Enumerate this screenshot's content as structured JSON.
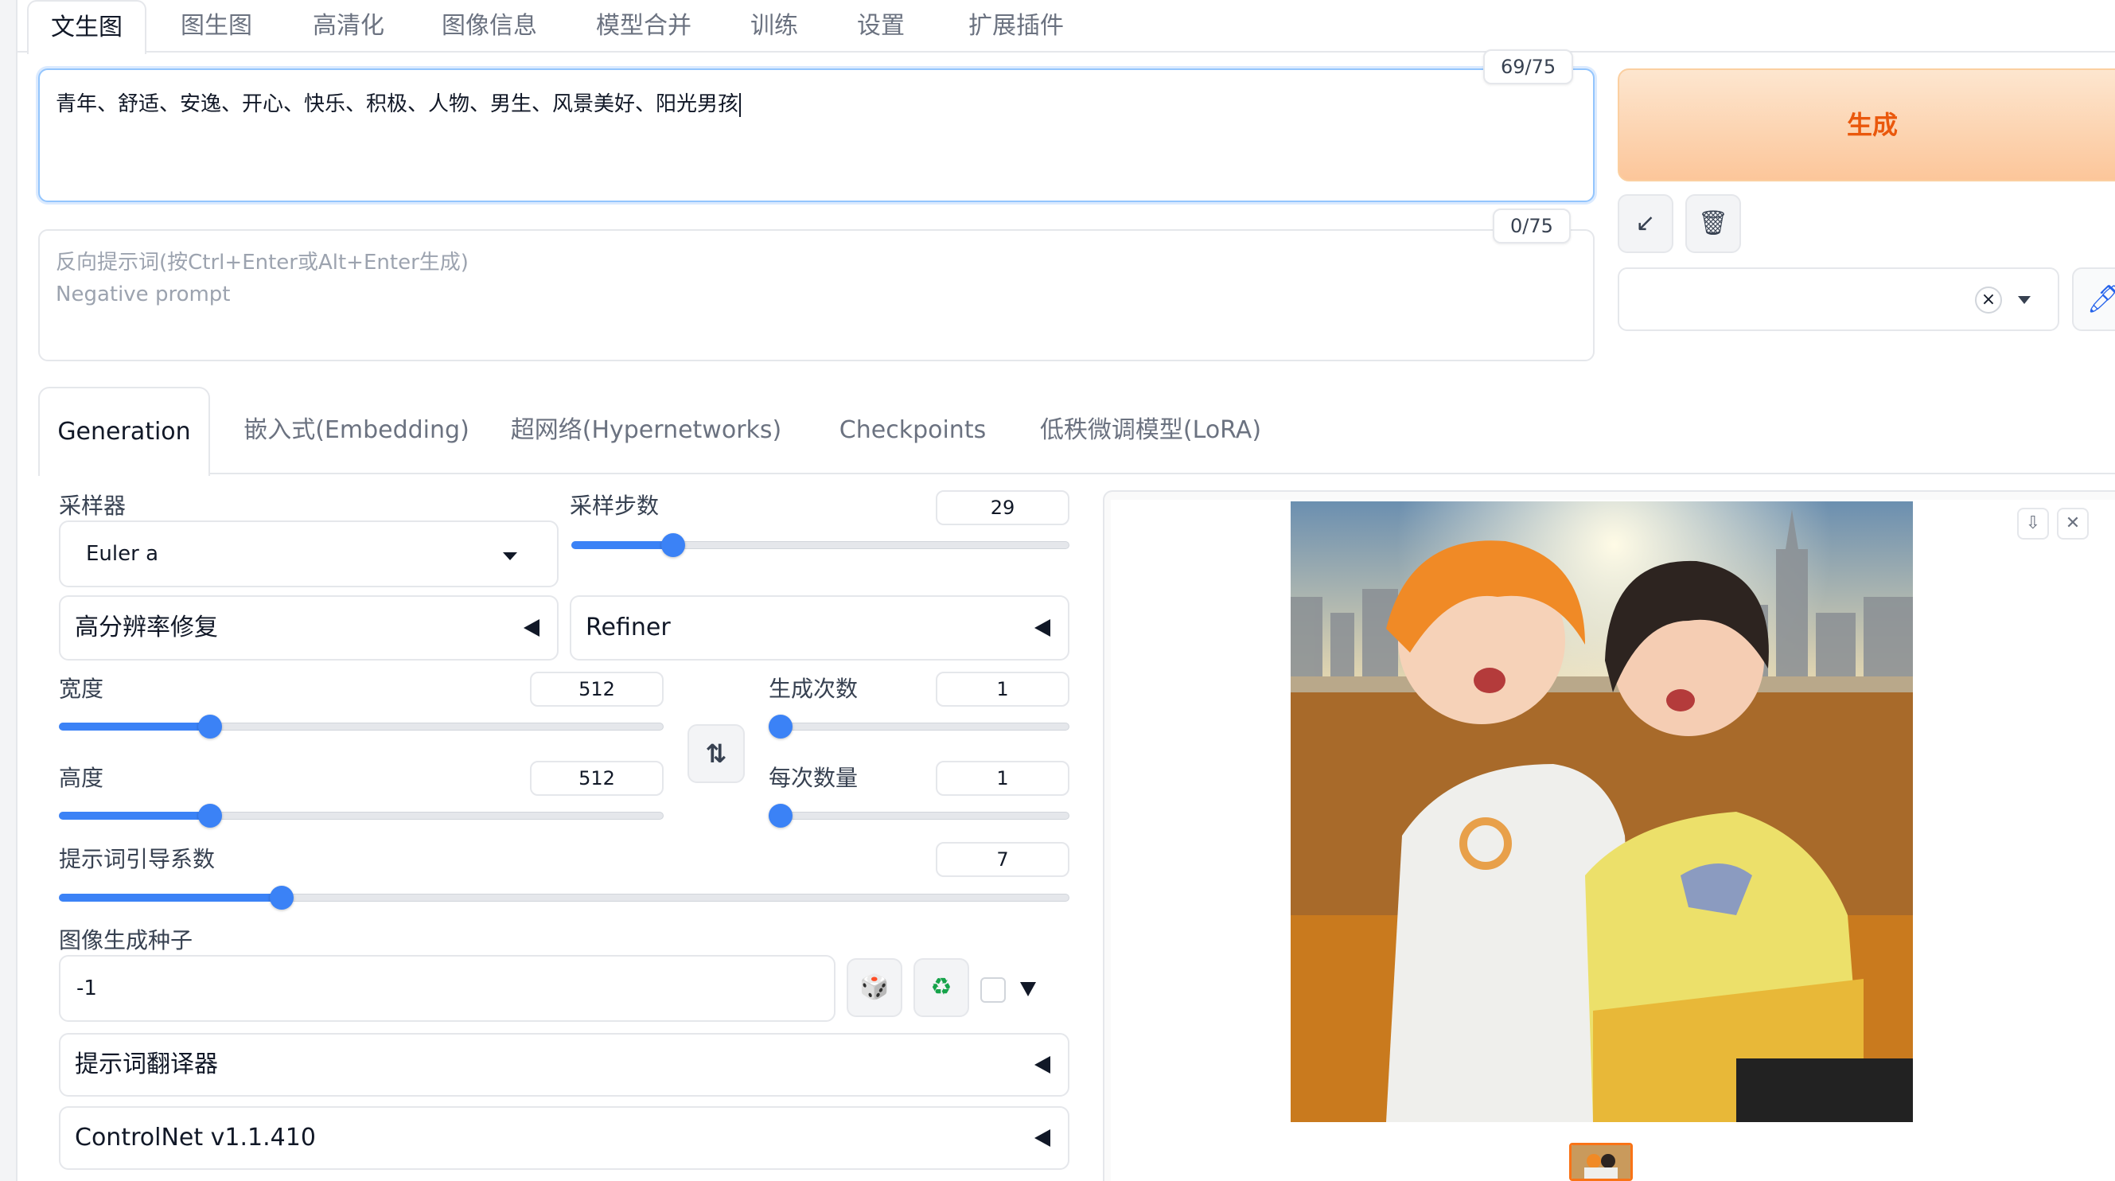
{
  "top_tabs": [
    "文生图",
    "图生图",
    "高清化",
    "图像信息",
    "模型合并",
    "训练",
    "设置",
    "扩展插件"
  ],
  "prompt": {
    "text": "青年、舒适、安逸、开心、快乐、积极、人物、男生、风景美好、阳光男孩",
    "counter": "69/75"
  },
  "negative_prompt": {
    "placeholder_line1": "反向提示词(按Ctrl+Enter或Alt+Enter生成)",
    "placeholder_line2": "Negative prompt",
    "counter": "0/75"
  },
  "generate_label": "生成",
  "icons": {
    "paste": "↙",
    "trash": "🗑",
    "clear": "×",
    "edit": "🖊",
    "swap": "⇅",
    "dice": "🎲",
    "recycle": "♻",
    "download": "⇩",
    "close": "✕"
  },
  "sub_tabs": [
    "Generation",
    "嵌入式(Embedding)",
    "超网络(Hypernetworks)",
    "Checkpoints",
    "低秩微调模型(LoRA)"
  ],
  "sampler": {
    "label": "采样器",
    "value": "Euler a"
  },
  "steps": {
    "label": "采样步数",
    "value": "29",
    "fraction": 0.19
  },
  "hires_fix": {
    "label": "高分辨率修复"
  },
  "refiner": {
    "label": "Refiner"
  },
  "width": {
    "label": "宽度",
    "value": "512",
    "fraction": 0.24
  },
  "height": {
    "label": "高度",
    "value": "512",
    "fraction": 0.24
  },
  "batch_count": {
    "label": "生成次数",
    "value": "1",
    "fraction": 0.0
  },
  "batch_size": {
    "label": "每次数量",
    "value": "1",
    "fraction": 0.0
  },
  "cfg_scale": {
    "label": "提示词引导系数",
    "value": "7",
    "fraction": 0.214
  },
  "seed": {
    "label": "图像生成种子",
    "value": "-1"
  },
  "prompt_translator": {
    "label": "提示词翻译器"
  },
  "controlnet": {
    "label": "ControlNet v1.1.410"
  },
  "colors": {
    "accent": "#3b82f6",
    "generate_text": "#ea580c",
    "generate_bg": "#fcc69a"
  }
}
